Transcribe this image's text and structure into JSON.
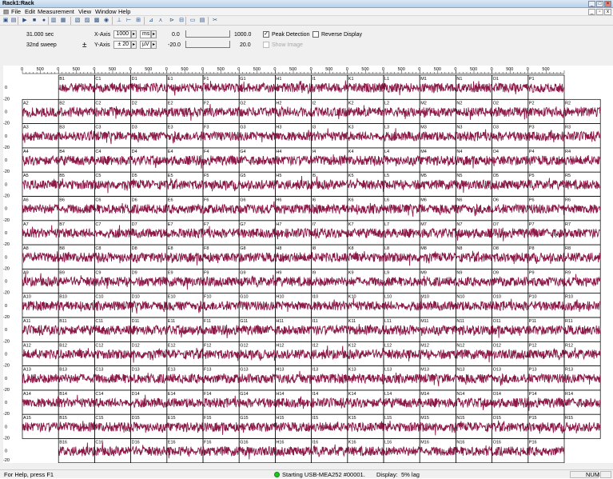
{
  "window": {
    "title": "Rack1:Rack"
  },
  "menu": [
    "File",
    "Edit",
    "Measurement",
    "View",
    "Window",
    "Help"
  ],
  "toolbar": {
    "icons": [
      "open-icon",
      "save-icon",
      "play-icon",
      "stop-icon",
      "record-icon",
      "grid-icon",
      "window-icon",
      "layout-icon",
      "layout-b-icon",
      "layout-c-icon",
      "speaker-icon",
      "trigger-icon",
      "filter-icon",
      "rack-icon",
      "peak-icon",
      "spike-icon",
      "marker-icon",
      "export-icon",
      "split-icon",
      "settings-icon",
      "scissors-icon"
    ]
  },
  "controls": {
    "time_value": "31.000 sec",
    "sweep_value": "32nd sweep",
    "xaxis_label": "X-Axis",
    "xaxis_value": "1000",
    "xaxis_unit": "ms",
    "yaxis_label": "Y-Axis",
    "yaxis_value": "± 20",
    "yaxis_unit": "µV",
    "x_min": "0.0",
    "x_max": "1000.0",
    "y_min": "-20.0",
    "y_max": "20.0",
    "peak_detection_label": "Peak Detection",
    "peak_detection_checked": true,
    "reverse_display_label": "Reverse Display",
    "reverse_display_checked": false,
    "show_image_label": "Show Image",
    "show_image_checked": false
  },
  "grid": {
    "columns": [
      "A",
      "B",
      "C",
      "D",
      "E",
      "F",
      "G",
      "H",
      "I",
      "K",
      "L",
      "M",
      "N",
      "O",
      "P",
      "R"
    ],
    "rows": [
      1,
      2,
      3,
      4,
      5,
      6,
      7,
      8,
      9,
      10,
      11,
      12,
      13,
      14,
      15,
      16
    ],
    "x_tick_labels": [
      "0",
      "500"
    ],
    "y_tick_top": "20",
    "y_tick_mid": "0",
    "y_tick_bottom": "-20",
    "trace_color": "#8b1a48"
  },
  "status": {
    "help_text": "For Help, press F1",
    "device_text": "Starting USB-MEA252 #00001.",
    "display_text": "Display:",
    "lag_text": "5% lag",
    "num_text": "NUM"
  }
}
